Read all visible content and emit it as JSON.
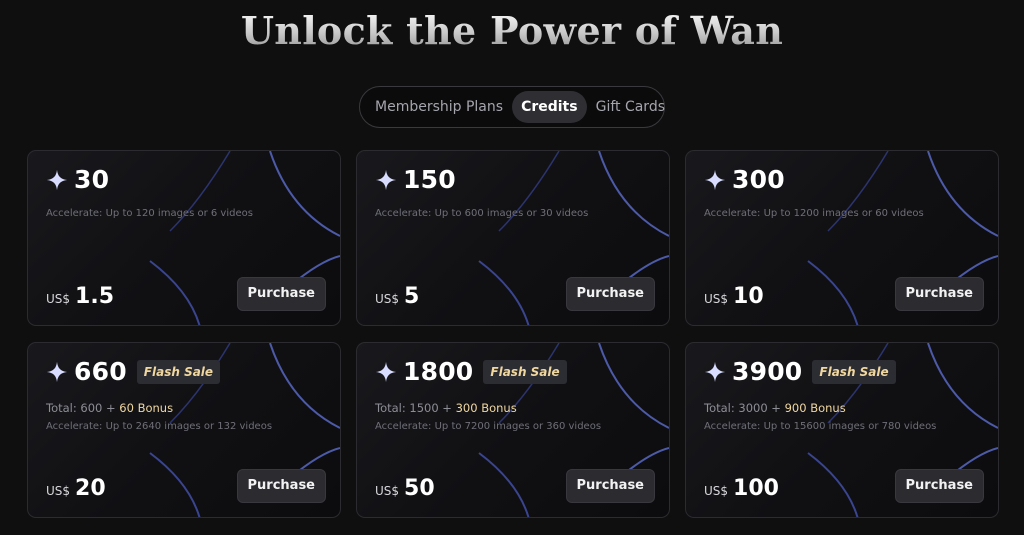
{
  "title": "Unlock the Power of Wan",
  "tabs": [
    {
      "label": "Membership Plans",
      "active": false
    },
    {
      "label": "Credits",
      "active": true
    },
    {
      "label": "Gift Cards",
      "active": false
    }
  ],
  "cards": [
    {
      "amount": "30",
      "flash_label": "",
      "total_base": "",
      "total_bonus": "",
      "accelerate": "Accelerate: Up to 120 images or 6 videos",
      "currency": "US$",
      "price": "1.5",
      "button": "Purchase"
    },
    {
      "amount": "150",
      "flash_label": "",
      "total_base": "",
      "total_bonus": "",
      "accelerate": "Accelerate: Up to 600 images or 30 videos",
      "currency": "US$",
      "price": "5",
      "button": "Purchase"
    },
    {
      "amount": "300",
      "flash_label": "",
      "total_base": "",
      "total_bonus": "",
      "accelerate": "Accelerate: Up to 1200 images or 60 videos",
      "currency": "US$",
      "price": "10",
      "button": "Purchase"
    },
    {
      "amount": "660",
      "flash_label": "Flash Sale",
      "total_base": "Total: 600 + ",
      "total_bonus": "60 Bonus",
      "accelerate": "Accelerate: Up to 2640 images or 132 videos",
      "currency": "US$",
      "price": "20",
      "button": "Purchase"
    },
    {
      "amount": "1800",
      "flash_label": "Flash Sale",
      "total_base": "Total: 1500 + ",
      "total_bonus": "300 Bonus",
      "accelerate": "Accelerate: Up to 7200 images or 360 videos",
      "currency": "US$",
      "price": "50",
      "button": "Purchase"
    },
    {
      "amount": "3900",
      "flash_label": "Flash Sale",
      "total_base": "Total: 3000 + ",
      "total_bonus": "900 Bonus",
      "accelerate": "Accelerate: Up to 15600 images or 780 videos",
      "currency": "US$",
      "price": "100",
      "button": "Purchase"
    }
  ],
  "icons": {
    "credit": "sparkle-icon"
  },
  "colors": {
    "background": "#0f0f10",
    "card": "#141417",
    "accent_gold": "#f0d7a0",
    "button": "#2b2b30",
    "decoration": "#4c5aa8"
  }
}
